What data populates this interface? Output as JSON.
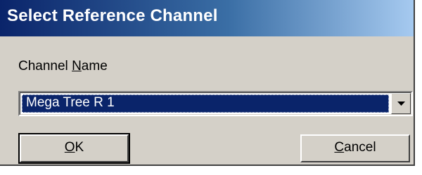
{
  "window": {
    "title": "Select Reference Channel"
  },
  "field": {
    "label_mnemonic": "N",
    "label_before": "Channel ",
    "label_after": "ame",
    "selected_value": "Mega Tree R 1"
  },
  "buttons": {
    "ok": {
      "mnemonic": "O",
      "rest": "K"
    },
    "cancel": {
      "mnemonic": "C",
      "rest": "ancel"
    }
  },
  "colors": {
    "titlebar_start": "#0a246a",
    "titlebar_end": "#a6caf0",
    "face": "#d4d0c8",
    "selection": "#0a246a"
  },
  "icons": {
    "dropdown": "chevron-down-icon"
  }
}
